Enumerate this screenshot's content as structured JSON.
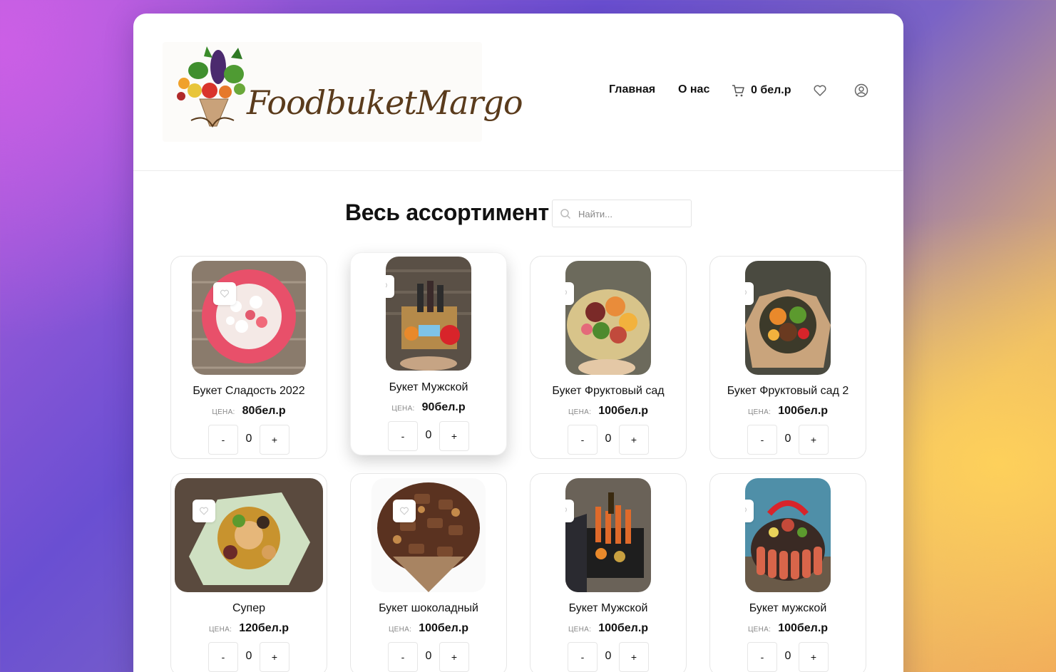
{
  "brand": {
    "logo_text": "FoodbuketMargo"
  },
  "nav": {
    "home": "Главная",
    "about": "О нас",
    "cart_total": "0 бел.р"
  },
  "catalog": {
    "title": "Весь ассортимент",
    "search_placeholder": "Найти...",
    "price_label": "ЦЕНА:"
  },
  "products": [
    {
      "name": "Букет Сладость 2022",
      "price": "80бел.р",
      "qty": "0"
    },
    {
      "name": "Букет Мужской",
      "price": "90бел.р",
      "qty": "0"
    },
    {
      "name": "Букет Фруктовый сад",
      "price": "100бел.р",
      "qty": "0"
    },
    {
      "name": "Букет Фруктовый сад 2",
      "price": "100бел.р",
      "qty": "0"
    },
    {
      "name": "Супер",
      "price": "120бел.р",
      "qty": "0"
    },
    {
      "name": "Букет шоколадный",
      "price": "100бел.р",
      "qty": "0"
    },
    {
      "name": "Букет Мужской",
      "price": "100бел.р",
      "qty": "0"
    },
    {
      "name": "Букет мужской",
      "price": "100бел.р",
      "qty": "0"
    }
  ],
  "buttons": {
    "minus": "-",
    "plus": "+"
  }
}
